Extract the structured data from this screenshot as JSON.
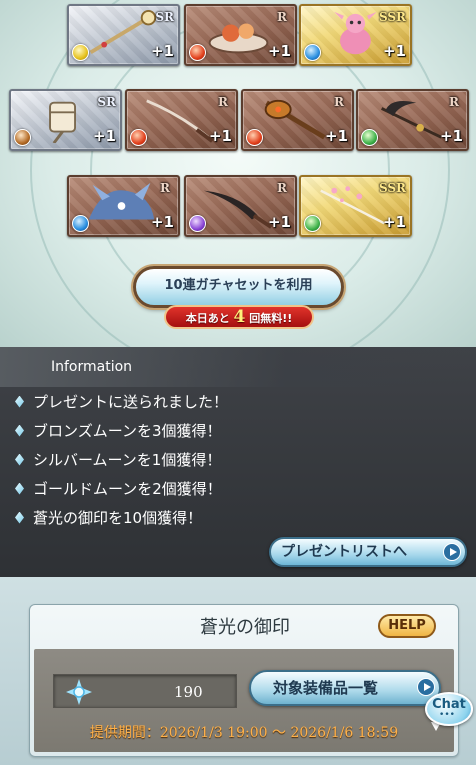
{
  "results": {
    "cards": [
      {
        "rarity": "SR",
        "element": "light",
        "plus": "+1",
        "art": "staff-icon"
      },
      {
        "rarity": "R",
        "element": "fire",
        "plus": "+1",
        "art": "food-plate-icon"
      },
      {
        "rarity": "SSR",
        "element": "water",
        "plus": "+1",
        "art": "pink-dragon-icon"
      },
      {
        "rarity": "SR",
        "element": "earth",
        "plus": "+1",
        "art": "lantern-staff-icon"
      },
      {
        "rarity": "R",
        "element": "fire",
        "plus": "+1",
        "art": "katana-icon"
      },
      {
        "rarity": "R",
        "element": "fire",
        "plus": "+1",
        "art": "mace-icon"
      },
      {
        "rarity": "R",
        "element": "wind",
        "plus": "+1",
        "art": "scythe-icon"
      },
      {
        "rarity": "R",
        "element": "water",
        "plus": "+1",
        "art": "blue-beast-icon"
      },
      {
        "rarity": "R",
        "element": "dark",
        "plus": "+1",
        "art": "dagger-icon"
      },
      {
        "rarity": "SSR",
        "element": "wind",
        "plus": "+1",
        "art": "sakura-sword-icon"
      }
    ],
    "gacha_button": "10連ガチャセットを利用",
    "free_badge": {
      "prefix": "本日あと",
      "count": "4",
      "suffix": "回無料!!"
    }
  },
  "information": {
    "title": "Information",
    "items": [
      "プレゼントに送られました！",
      "ブロンズムーンを3個獲得！",
      "シルバームーンを1個獲得！",
      "ゴールドムーンを2個獲得！",
      "蒼光の御印を10個獲得！"
    ],
    "present_button": "プレゼントリストへ"
  },
  "item_panel": {
    "title": "蒼光の御印",
    "help": "HELP",
    "count": "190",
    "equip_button": "対象装備品一覧",
    "period": "提供期間：2026/1/3 19:00 〜 2026/1/6 18:59"
  },
  "chat": {
    "label": "Chat",
    "dots": "•••"
  },
  "colors": {
    "info_bg": "#3f4247",
    "period_text": "#ffb14a",
    "button_blue": "#acd9ea",
    "free_badge_red": "#c42020"
  }
}
